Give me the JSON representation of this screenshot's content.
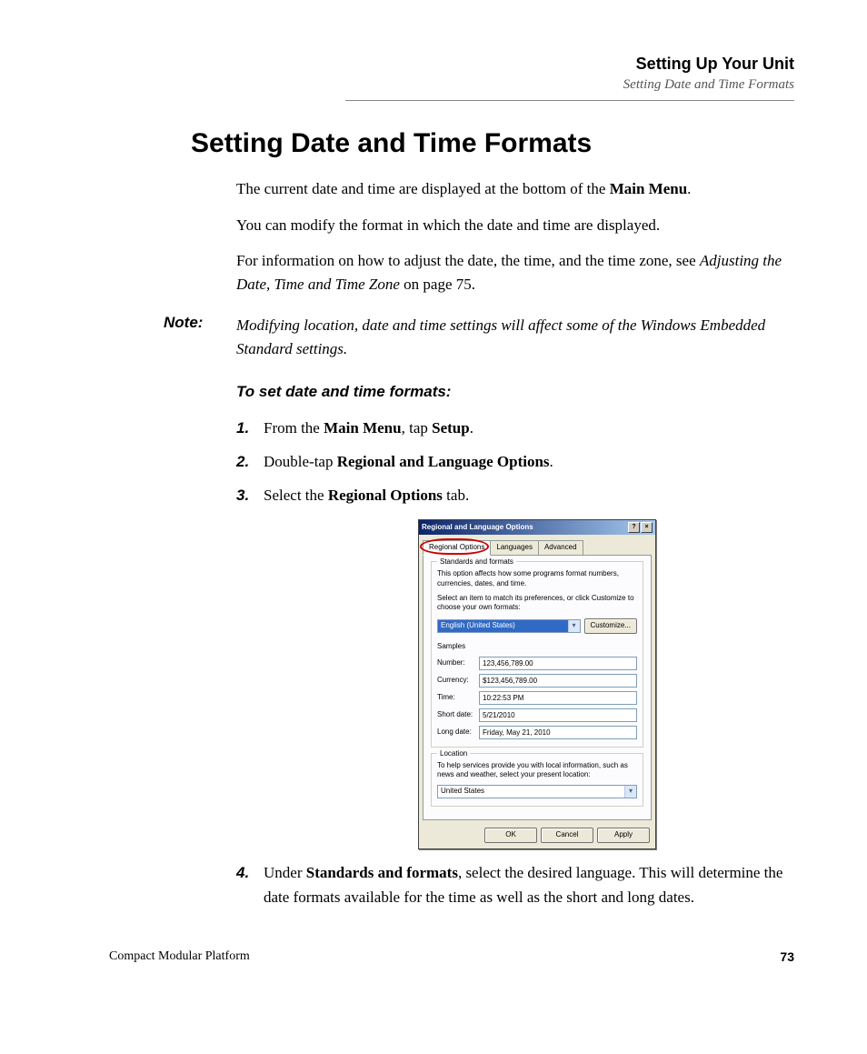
{
  "header": {
    "chapter": "Setting Up Your Unit",
    "section": "Setting Date and Time Formats"
  },
  "heading": "Setting Date and Time Formats",
  "paragraphs": {
    "p1_a": "The current date and time are displayed at the bottom of the ",
    "p1_b": "Main Menu",
    "p1_c": ".",
    "p2": "You can modify the format in which the date and time are displayed.",
    "p3_a": "For information on how to adjust the date, the time, and the time zone, see ",
    "p3_b": "Adjusting the Date, Time and Time Zone",
    "p3_c": " on page 75."
  },
  "note": {
    "label": "Note:",
    "text": "Modifying location, date and time settings will affect some of the Windows Embedded Standard settings."
  },
  "procedure_title": "To set date and time formats:",
  "steps": {
    "s1_a": "From the ",
    "s1_b": "Main Menu",
    "s1_c": ", tap ",
    "s1_d": "Setup",
    "s1_e": ".",
    "s2_a": "Double-tap ",
    "s2_b": "Regional and Language Options",
    "s2_c": ".",
    "s3_a": "Select the ",
    "s3_b": "Regional Options",
    "s3_c": " tab.",
    "s4_a": "Under ",
    "s4_b": "Standards and formats",
    "s4_c": ", select the desired language. This will determine the date formats available for the time as well as the short and long dates."
  },
  "dialog": {
    "title": "Regional and Language Options",
    "help_btn": "?",
    "close_btn": "×",
    "tabs": {
      "t1": "Regional Options",
      "t2": "Languages",
      "t3": "Advanced"
    },
    "stdfmt": {
      "group": "Standards and formats",
      "desc1": "This option affects how some programs format numbers, currencies, dates, and time.",
      "desc2": "Select an item to match its preferences, or click Customize to choose your own formats:",
      "locale": "English (United States)",
      "customize": "Customize...",
      "samples_label": "Samples",
      "labels": {
        "number": "Number:",
        "currency": "Currency:",
        "time": "Time:",
        "shortdate": "Short date:",
        "longdate": "Long date:"
      },
      "values": {
        "number": "123,456,789.00",
        "currency": "$123,456,789.00",
        "time": "10:22:53 PM",
        "shortdate": "5/21/2010",
        "longdate": "Friday, May 21, 2010"
      }
    },
    "location": {
      "group": "Location",
      "desc": "To help services provide you with local information, such as news and weather, select your present location:",
      "value": "United States"
    },
    "buttons": {
      "ok": "OK",
      "cancel": "Cancel",
      "apply": "Apply"
    }
  },
  "footer": {
    "product": "Compact Modular Platform",
    "page": "73"
  }
}
